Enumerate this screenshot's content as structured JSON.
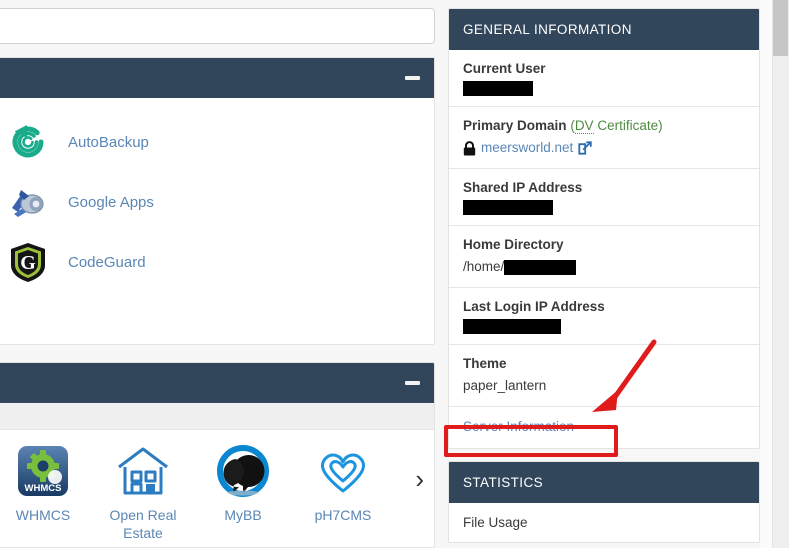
{
  "search": {
    "value": "",
    "placeholder": ""
  },
  "addons_panel": {
    "title": "",
    "collapse_label": "–",
    "items": [
      {
        "label": "AutoBackup",
        "icon": "autobackup-icon"
      },
      {
        "label": "Google Apps",
        "icon": "google-apps-icon"
      },
      {
        "label": "CodeGuard",
        "icon": "codeguard-icon"
      }
    ]
  },
  "apps_panel": {
    "title": "",
    "collapse_label": "–",
    "next_label": "›",
    "apps": [
      {
        "label": "WHMCS",
        "icon": "whmcs-icon"
      },
      {
        "label": "Open Real Estate",
        "icon": "open-real-estate-icon"
      },
      {
        "label": "MyBB",
        "icon": "mybb-icon"
      },
      {
        "label": "pH7CMS",
        "icon": "ph7cms-icon"
      }
    ]
  },
  "general_information": {
    "header": "GENERAL INFORMATION",
    "rows": [
      {
        "label": "Current User",
        "value": "",
        "redacted": true,
        "redacted_width": 70
      },
      {
        "label": "Primary Domain",
        "label_suffix": "(DV Certificate)",
        "value": "meersworld.net",
        "redacted": false,
        "has_lock": true,
        "has_external": true
      },
      {
        "label": "Shared IP Address",
        "value": "",
        "redacted": true,
        "redacted_width": 90
      },
      {
        "label": "Home Directory",
        "value": "/home/",
        "redacted": true,
        "redacted_width": 72
      },
      {
        "label": "Last Login IP Address",
        "value": "",
        "redacted": true,
        "redacted_width": 98
      },
      {
        "label": "Theme",
        "value": "paper_lantern",
        "redacted": false
      }
    ],
    "server_information_link": "Server Information"
  },
  "statistics": {
    "header": "STATISTICS",
    "rows": [
      {
        "label": "File Usage"
      }
    ]
  },
  "annotations": {
    "highlight_color": "#e01b1b",
    "arrow_color": "#e01b1b",
    "highlight_target": "Server Information"
  },
  "colors": {
    "panel_header": "#31455b",
    "link": "#5a87b5",
    "cert_green": "#4f8a42",
    "annotation_red": "#e01b1b"
  },
  "scrollbar": {
    "position": "top"
  }
}
